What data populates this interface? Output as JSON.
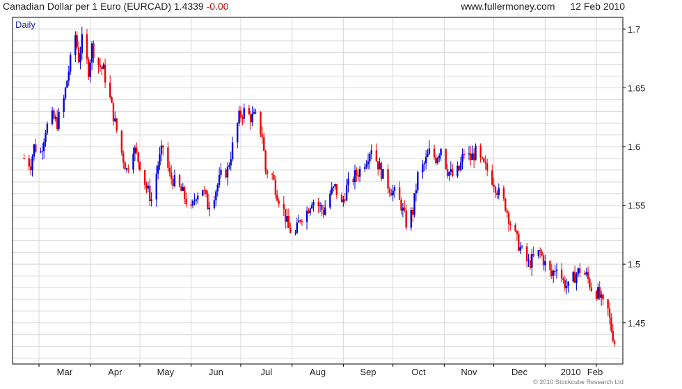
{
  "header": {
    "title": "Canadian Dollar per 1 Euro (EURCAD)",
    "last": "1.4339",
    "change": "-0.00",
    "site": "www.fullermoney.com",
    "date": "12 Feb 2010"
  },
  "copyright": "© 2010 Stockcube Research Ltd",
  "chart_data": {
    "type": "candlestick",
    "interval_label": "Daily",
    "ylim": [
      1.415,
      1.71
    ],
    "y_ticks": [
      1.45,
      1.5,
      1.55,
      1.6,
      1.65,
      1.7
    ],
    "x_tick_labels": [
      "Mar",
      "Apr",
      "May",
      "Jun",
      "Jul",
      "Aug",
      "Sep",
      "Oct",
      "Nov",
      "Dec",
      "2010",
      "Feb"
    ],
    "grid": true,
    "colors": {
      "up": "#0000dd",
      "down": "#ee0000",
      "grid": "#d8d8d8",
      "axis": "#000000"
    },
    "control_points": [
      [
        "2009-02-20",
        1.59
      ],
      [
        "2009-02-24",
        1.585
      ],
      [
        "2009-02-26",
        1.6
      ],
      [
        "2009-03-02",
        1.595
      ],
      [
        "2009-03-05",
        1.615
      ],
      [
        "2009-03-09",
        1.625
      ],
      [
        "2009-03-12",
        1.62
      ],
      [
        "2009-03-16",
        1.64
      ],
      [
        "2009-03-19",
        1.665
      ],
      [
        "2009-03-23",
        1.695
      ],
      [
        "2009-03-25",
        1.675
      ],
      [
        "2009-03-27",
        1.69
      ],
      [
        "2009-03-31",
        1.665
      ],
      [
        "2009-04-02",
        1.685
      ],
      [
        "2009-04-06",
        1.67
      ],
      [
        "2009-04-09",
        1.665
      ],
      [
        "2009-04-13",
        1.64
      ],
      [
        "2009-04-16",
        1.62
      ],
      [
        "2009-04-20",
        1.595
      ],
      [
        "2009-04-23",
        1.58
      ],
      [
        "2009-04-27",
        1.6
      ],
      [
        "2009-05-01",
        1.585
      ],
      [
        "2009-05-05",
        1.565
      ],
      [
        "2009-05-08",
        1.555
      ],
      [
        "2009-05-12",
        1.585
      ],
      [
        "2009-05-15",
        1.6
      ],
      [
        "2009-05-19",
        1.575
      ],
      [
        "2009-05-22",
        1.57
      ],
      [
        "2009-05-27",
        1.56
      ],
      [
        "2009-06-01",
        1.545
      ],
      [
        "2009-06-04",
        1.56
      ],
      [
        "2009-06-08",
        1.565
      ],
      [
        "2009-06-11",
        1.55
      ],
      [
        "2009-06-15",
        1.56
      ],
      [
        "2009-06-19",
        1.575
      ],
      [
        "2009-06-23",
        1.58
      ],
      [
        "2009-06-26",
        1.6
      ],
      [
        "2009-06-30",
        1.625
      ],
      [
        "2009-07-03",
        1.63
      ],
      [
        "2009-07-07",
        1.625
      ],
      [
        "2009-07-10",
        1.625
      ],
      [
        "2009-07-14",
        1.61
      ],
      [
        "2009-07-16",
        1.58
      ],
      [
        "2009-07-20",
        1.575
      ],
      [
        "2009-07-23",
        1.56
      ],
      [
        "2009-07-27",
        1.545
      ],
      [
        "2009-07-30",
        1.53
      ],
      [
        "2009-08-03",
        1.525
      ],
      [
        "2009-08-06",
        1.54
      ],
      [
        "2009-08-10",
        1.545
      ],
      [
        "2009-08-13",
        1.555
      ],
      [
        "2009-08-17",
        1.55
      ],
      [
        "2009-08-20",
        1.545
      ],
      [
        "2009-08-24",
        1.56
      ],
      [
        "2009-08-27",
        1.565
      ],
      [
        "2009-08-31",
        1.55
      ],
      [
        "2009-09-03",
        1.565
      ],
      [
        "2009-09-08",
        1.575
      ],
      [
        "2009-09-11",
        1.58
      ],
      [
        "2009-09-15",
        1.59
      ],
      [
        "2009-09-18",
        1.6
      ],
      [
        "2009-09-22",
        1.585
      ],
      [
        "2009-09-25",
        1.575
      ],
      [
        "2009-09-29",
        1.565
      ],
      [
        "2009-10-02",
        1.56
      ],
      [
        "2009-10-06",
        1.55
      ],
      [
        "2009-10-09",
        1.535
      ],
      [
        "2009-10-13",
        1.545
      ],
      [
        "2009-10-16",
        1.575
      ],
      [
        "2009-10-20",
        1.585
      ],
      [
        "2009-10-23",
        1.595
      ],
      [
        "2009-10-27",
        1.59
      ],
      [
        "2009-10-30",
        1.6
      ],
      [
        "2009-11-03",
        1.58
      ],
      [
        "2009-11-06",
        1.575
      ],
      [
        "2009-11-10",
        1.58
      ],
      [
        "2009-11-13",
        1.595
      ],
      [
        "2009-11-17",
        1.59
      ],
      [
        "2009-11-20",
        1.595
      ],
      [
        "2009-11-24",
        1.585
      ],
      [
        "2009-11-27",
        1.58
      ],
      [
        "2009-12-01",
        1.57
      ],
      [
        "2009-12-04",
        1.56
      ],
      [
        "2009-12-08",
        1.55
      ],
      [
        "2009-12-11",
        1.535
      ],
      [
        "2009-12-15",
        1.52
      ],
      [
        "2009-12-18",
        1.51
      ],
      [
        "2009-12-22",
        1.5
      ],
      [
        "2009-12-25",
        1.505
      ],
      [
        "2009-12-29",
        1.51
      ],
      [
        "2010-01-01",
        1.5
      ],
      [
        "2010-01-05",
        1.49
      ],
      [
        "2010-01-08",
        1.5
      ],
      [
        "2010-01-12",
        1.485
      ],
      [
        "2010-01-15",
        1.48
      ],
      [
        "2010-01-19",
        1.49
      ],
      [
        "2010-01-22",
        1.495
      ],
      [
        "2010-01-26",
        1.49
      ],
      [
        "2010-01-29",
        1.48
      ],
      [
        "2010-02-02",
        1.475
      ],
      [
        "2010-02-05",
        1.465
      ],
      [
        "2010-02-08",
        1.46
      ],
      [
        "2010-02-10",
        1.445
      ],
      [
        "2010-02-12",
        1.434
      ]
    ]
  }
}
